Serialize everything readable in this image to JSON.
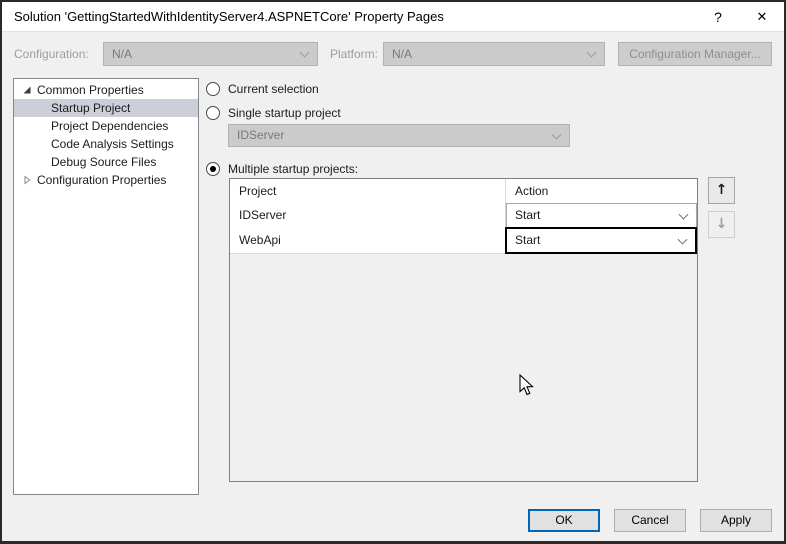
{
  "window": {
    "title": "Solution 'GettingStartedWithIdentityServer4.ASPNETCore' Property Pages",
    "help": "?",
    "close": "✕"
  },
  "toolbar": {
    "configuration_label": "Configuration:",
    "configuration_value": "N/A",
    "platform_label": "Platform:",
    "platform_value": "N/A",
    "configuration_manager_label": "Configuration Manager..."
  },
  "sidebar": {
    "items": [
      {
        "label": "Common Properties",
        "level": 0,
        "state": "expanded"
      },
      {
        "label": "Startup Project",
        "level": 1,
        "state": "selected"
      },
      {
        "label": "Project Dependencies",
        "level": 1,
        "state": "normal"
      },
      {
        "label": "Code Analysis Settings",
        "level": 1,
        "state": "normal"
      },
      {
        "label": "Debug Source Files",
        "level": 1,
        "state": "normal"
      },
      {
        "label": "Configuration Properties",
        "level": 0,
        "state": "collapsed"
      }
    ]
  },
  "startup": {
    "current_selection_label": "Current selection",
    "single_startup_label": "Single startup project",
    "single_project_value": "IDServer",
    "multiple_startup_label": "Multiple startup projects:",
    "selected_option": "multiple"
  },
  "projects_table": {
    "columns": [
      "Project",
      "Action"
    ],
    "rows": [
      {
        "project": "IDServer",
        "action": "Start",
        "focused": false
      },
      {
        "project": "WebApi",
        "action": "Start",
        "focused": true
      }
    ]
  },
  "reorder": {
    "up_icon": "↑",
    "down_icon": "↓"
  },
  "footer": {
    "ok_label": "OK",
    "cancel_label": "Cancel",
    "apply_label": "Apply"
  },
  "colors": {
    "dialog_bg": "#f0f0f0",
    "titlebar_bg": "#ffffff",
    "tree_selection_bg": "#ccceda",
    "focus_blue": "#0067b8",
    "disabled_fill": "#cbcbcb"
  }
}
